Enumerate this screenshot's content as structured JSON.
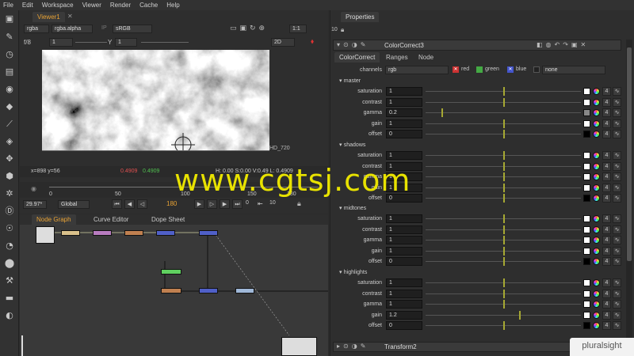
{
  "menu": [
    "File",
    "Edit",
    "Workspace",
    "Viewer",
    "Render",
    "Cache",
    "Help"
  ],
  "viewer": {
    "tab_label": "Viewer1",
    "channels": "rgba",
    "alpha": "rgba.alpha",
    "ip": "IP",
    "colorspace": "sRGB",
    "zoom": "1:1",
    "fstop": "f/8",
    "gain": "1",
    "gamma_label": "Y",
    "gamma": "1",
    "view_mode": "2D",
    "format_label": "HD_720",
    "coords": "x=898 y=56",
    "pixel_r": "0.4909",
    "pixel_g": "0.4909",
    "pixel_rest": "H: 0.00 S:0.00 V:0.49 L: 0.4909",
    "timeline_ticks": [
      "0",
      "50",
      "100",
      "150",
      "180"
    ],
    "fps": "29.97*",
    "global": "Global",
    "frame": "180",
    "frame_start": "0",
    "step": "10"
  },
  "node_graph": {
    "tabs": [
      "Node Graph",
      "Curve Editor",
      "Dope Sheet"
    ]
  },
  "properties": {
    "tab_label": "Properties",
    "panel_count": "10",
    "node_name": "ColorCorrect3",
    "subtabs": [
      "ColorCorrect",
      "Ranges",
      "Node"
    ],
    "channels_label": "channels",
    "channels_value": "rgb",
    "red": "red",
    "green": "green",
    "blue": "blue",
    "mask": "none",
    "sections": [
      {
        "name": "master",
        "params": [
          {
            "label": "saturation",
            "value": "1"
          },
          {
            "label": "contrast",
            "value": "1"
          },
          {
            "label": "gamma",
            "value": "0.2"
          },
          {
            "label": "gain",
            "value": "1"
          },
          {
            "label": "offset",
            "value": "0"
          }
        ]
      },
      {
        "name": "shadows",
        "params": [
          {
            "label": "saturation",
            "value": "1"
          },
          {
            "label": "contrast",
            "value": "1"
          },
          {
            "label": "gamma",
            "value": "1"
          },
          {
            "label": "gain",
            "value": "1"
          },
          {
            "label": "offset",
            "value": "0"
          }
        ]
      },
      {
        "name": "midtones",
        "params": [
          {
            "label": "saturation",
            "value": "1"
          },
          {
            "label": "contrast",
            "value": "1"
          },
          {
            "label": "gamma",
            "value": "1"
          },
          {
            "label": "gain",
            "value": "1"
          },
          {
            "label": "offset",
            "value": "0"
          }
        ]
      },
      {
        "name": "highlights",
        "params": [
          {
            "label": "saturation",
            "value": "1"
          },
          {
            "label": "contrast",
            "value": "1"
          },
          {
            "label": "gamma",
            "value": "1"
          },
          {
            "label": "gain",
            "value": "1.2"
          },
          {
            "label": "offset",
            "value": "0"
          }
        ]
      }
    ],
    "four": "4",
    "next_node": "Transform2"
  },
  "watermark": "www.cgtsj.com",
  "brand": "pluralsight",
  "colors": {
    "accent": "#e8a234",
    "handle": "#a6a833",
    "watermark": "#e8e200"
  }
}
